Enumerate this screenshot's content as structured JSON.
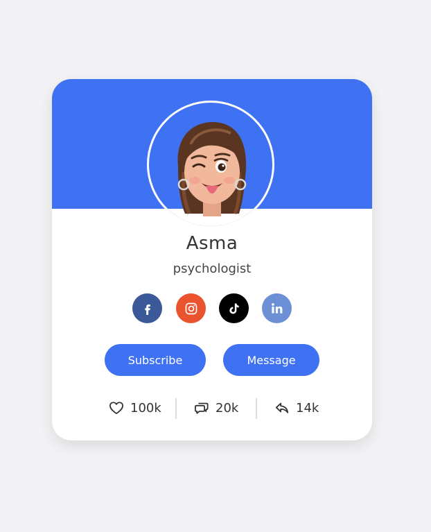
{
  "profile": {
    "name": "Asma",
    "role": "psychologist"
  },
  "social_links": [
    {
      "icon": "facebook-icon",
      "glyph": "f",
      "color": "#3b5998"
    },
    {
      "icon": "instagram-icon",
      "glyph": "",
      "color": "#e9532d"
    },
    {
      "icon": "tiktok-icon",
      "glyph": "",
      "color": "#000000"
    },
    {
      "icon": "linkedin-icon",
      "glyph": "in",
      "color": "#6d8fd6"
    }
  ],
  "buttons": {
    "subscribe_label": "Subscribe",
    "message_label": "Message"
  },
  "stats": {
    "likes": "100k",
    "comments": "20k",
    "shares": "14k"
  },
  "colors": {
    "accent": "#3f72f2",
    "background": "#f3f3f5",
    "card": "#ffffff"
  }
}
